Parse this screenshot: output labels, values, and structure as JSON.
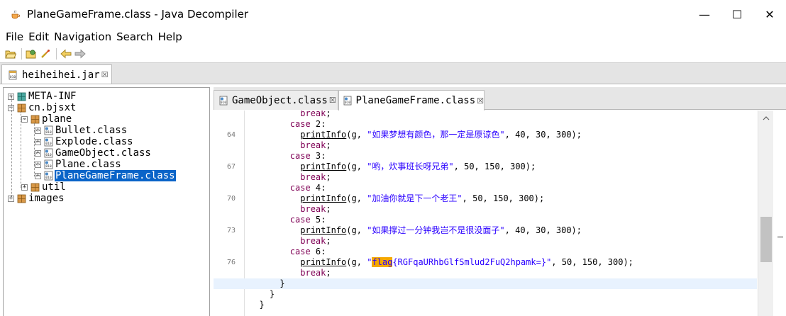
{
  "window": {
    "title": "PlaneGameFrame.class - Java Decompiler",
    "minimize": "—",
    "maximize": "☐",
    "close": "✕"
  },
  "menu": [
    "File",
    "Edit",
    "Navigation",
    "Search",
    "Help"
  ],
  "toolbar": {
    "icons": [
      "open-file-icon",
      "open-type-icon",
      "search-icon",
      "back-arrow-icon",
      "forward-arrow-icon"
    ]
  },
  "outer_tab": {
    "label": "heiheihei.jar",
    "close": "☒"
  },
  "tree": {
    "nodes": [
      {
        "label": "META-INF",
        "expander": "+",
        "icon": "package-icon"
      },
      {
        "label": "cn.bjsxt",
        "expander": "−",
        "icon": "package-icon"
      },
      {
        "label": "plane",
        "expander": "−",
        "icon": "package-icon"
      },
      {
        "label": "Bullet.class",
        "expander": "+",
        "icon": "class-file-icon"
      },
      {
        "label": "Explode.class",
        "expander": "+",
        "icon": "class-file-icon"
      },
      {
        "label": "GameObject.class",
        "expander": "+",
        "icon": "class-file-icon"
      },
      {
        "label": "Plane.class",
        "expander": "+",
        "icon": "class-file-icon"
      },
      {
        "label": "PlaneGameFrame.class",
        "expander": "+",
        "icon": "class-file-icon",
        "selected": true
      },
      {
        "label": "util",
        "expander": "+",
        "icon": "package-icon"
      },
      {
        "label": "images",
        "expander": "+",
        "icon": "package-icon"
      }
    ]
  },
  "editor": {
    "tabs": [
      {
        "label": "GameObject.class",
        "close": "☒",
        "active": false
      },
      {
        "label": "PlaneGameFrame.class",
        "close": "☒",
        "active": true
      }
    ],
    "lines": [
      {
        "num": "",
        "text": "          break;"
      },
      {
        "num": "",
        "text": "        case 2:"
      },
      {
        "num": "64",
        "text": "          printInfo(g, \"如果梦想有颜色，那一定是原谅色\", 40, 30, 300);"
      },
      {
        "num": "",
        "text": "          break;"
      },
      {
        "num": "",
        "text": "        case 3:"
      },
      {
        "num": "67",
        "text": "          printInfo(g, \"哟，炊事班长呀兄弟\", 50, 150, 300);"
      },
      {
        "num": "",
        "text": "          break;"
      },
      {
        "num": "",
        "text": "        case 4:"
      },
      {
        "num": "70",
        "text": "          printInfo(g, \"加油你就是下一个老王\", 50, 150, 300);"
      },
      {
        "num": "",
        "text": "          break;"
      },
      {
        "num": "",
        "text": "        case 5:"
      },
      {
        "num": "73",
        "text": "          printInfo(g, \"如果撑过一分钟我岂不是很没面子\", 40, 30, 300);"
      },
      {
        "num": "",
        "text": "          break;"
      },
      {
        "num": "",
        "text": "        case 6:"
      },
      {
        "num": "76",
        "text": "          printInfo(g, \"flag{RGFqaURhbGlfSmlud2FuQ2hpamk=}\", 50, 150, 300);",
        "highlight_word": "flag"
      },
      {
        "num": "",
        "text": "          break;"
      },
      {
        "num": "",
        "text": "      }",
        "current": true
      },
      {
        "num": "",
        "text": "    }"
      },
      {
        "num": "",
        "text": "  }"
      }
    ]
  },
  "colors": {
    "keyword": "#7f0055",
    "string": "#2a00ff",
    "selection": "#0a64c8",
    "search_highlight": "#f5a700",
    "current_line": "#e8f2fe"
  }
}
